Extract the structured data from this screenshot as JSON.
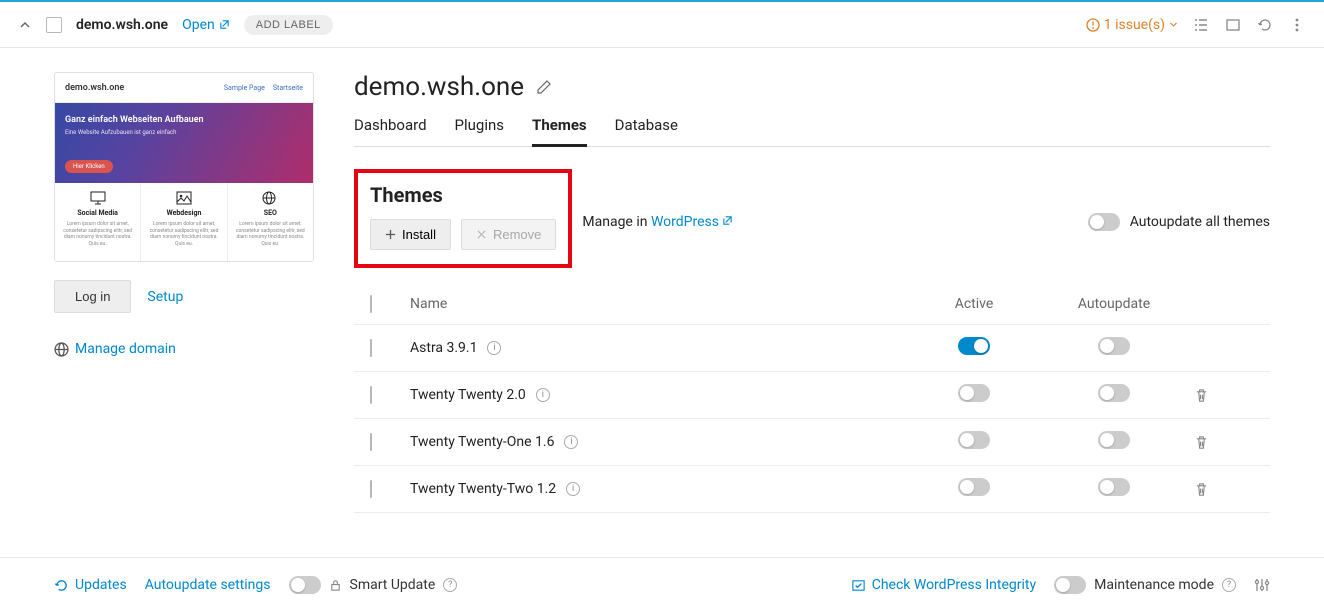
{
  "topbar": {
    "site_name": "demo.wsh.one",
    "open_label": "Open",
    "add_label_label": "ADD LABEL",
    "issues_label": "1 issue(s)"
  },
  "sidebar": {
    "preview": {
      "domain": "demo.wsh.one",
      "nav_links": [
        "Sample Page",
        "Startseite"
      ],
      "hero_title": "Ganz einfach Webseiten Aufbauen",
      "hero_sub": "Eine Website Aufzubauen ist ganz einfach",
      "hero_btn": "Hier Klicken",
      "cards": [
        {
          "title": "Social Media",
          "text": "Lorem ipsum dolor sit amet, consetetur sadipscing elitr, sed diam nonumy tincidunt nostra. Quis eu."
        },
        {
          "title": "Webdesign",
          "text": "Lorem ipsum dolor sit amet, consetetur sadipscing elitr, sed diam nonumy tincidunt nostra. Quis eu."
        },
        {
          "title": "SEO",
          "text": "Lorem ipsum dolor sit amet, consetetur sadipscing elitr, sed diam nonumy tincidunt nostra. Quis eu."
        }
      ]
    },
    "login_label": "Log in",
    "setup_label": "Setup",
    "manage_domain_label": "Manage domain"
  },
  "content": {
    "title": "demo.wsh.one",
    "tabs": [
      {
        "label": "Dashboard",
        "active": false
      },
      {
        "label": "Plugins",
        "active": false
      },
      {
        "label": "Themes",
        "active": true
      },
      {
        "label": "Database",
        "active": false
      }
    ],
    "section_title": "Themes",
    "install_label": "Install",
    "remove_label": "Remove",
    "manage_in_prefix": "Manage in ",
    "manage_in_link": "WordPress",
    "autoupdate_all_label": "Autoupdate all themes",
    "columns": {
      "name": "Name",
      "active": "Active",
      "autoupdate": "Autoupdate"
    },
    "themes": [
      {
        "name": "Astra 3.9.1",
        "active": true,
        "autoupdate": false,
        "deletable": false
      },
      {
        "name": "Twenty Twenty 2.0",
        "active": false,
        "autoupdate": false,
        "deletable": true
      },
      {
        "name": "Twenty Twenty-One 1.6",
        "active": false,
        "autoupdate": false,
        "deletable": true
      },
      {
        "name": "Twenty Twenty-Two 1.2",
        "active": false,
        "autoupdate": false,
        "deletable": true
      }
    ]
  },
  "footer": {
    "updates_label": "Updates",
    "autoupdate_settings_label": "Autoupdate settings",
    "smart_update_label": "Smart Update",
    "check_integrity_label": "Check WordPress Integrity",
    "maintenance_label": "Maintenance mode"
  }
}
